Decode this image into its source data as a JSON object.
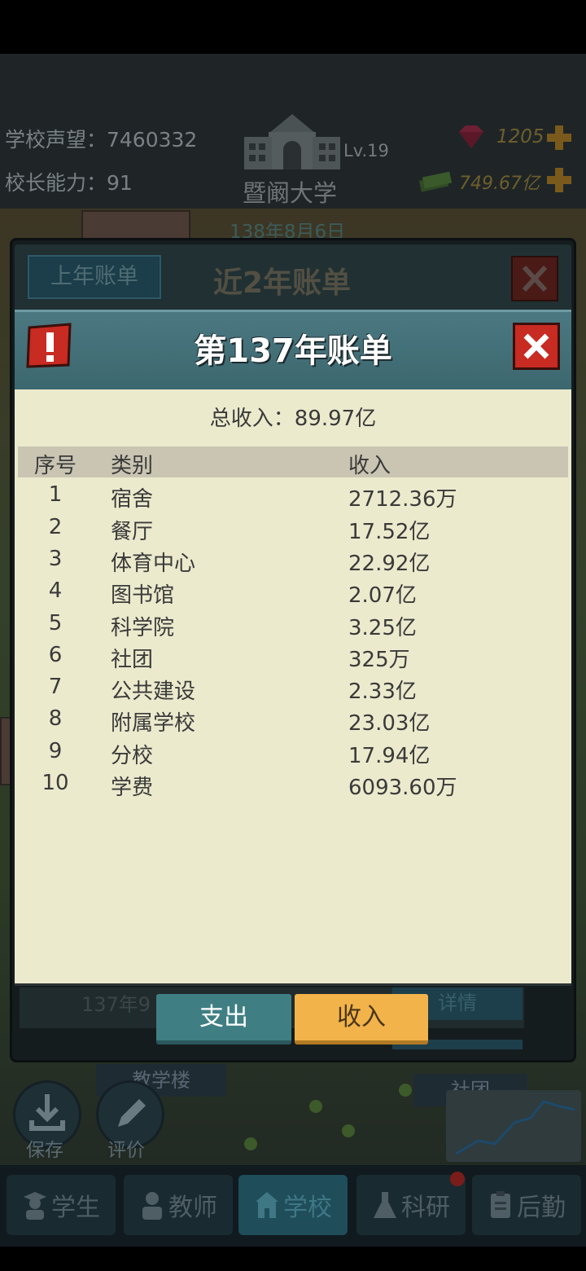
{
  "header": {
    "reputation_label": "学校声望：7460332",
    "ability_label": "校长能力：91",
    "school_name": "暨阚大学",
    "school_level": "Lv.19",
    "gems": "1205",
    "money": "749.67亿",
    "game_date": "138年8月6日"
  },
  "back_dialog": {
    "last_year_button": "上年账单",
    "title": "近2年账单",
    "behind_text": "137年9",
    "detail_button": "详情"
  },
  "front_dialog": {
    "title": "第137年账单",
    "total_income": "总收入：89.97亿",
    "columns": [
      "序号",
      "类别",
      "收入"
    ],
    "rows": [
      {
        "idx": "1",
        "category": "宿舍",
        "income": "2712.36万"
      },
      {
        "idx": "2",
        "category": "餐厅",
        "income": "17.52亿"
      },
      {
        "idx": "3",
        "category": "体育中心",
        "income": "22.92亿"
      },
      {
        "idx": "4",
        "category": "图书馆",
        "income": "2.07亿"
      },
      {
        "idx": "5",
        "category": "科学院",
        "income": "3.25亿"
      },
      {
        "idx": "6",
        "category": "社团",
        "income": "325万"
      },
      {
        "idx": "7",
        "category": "公共建设",
        "income": "2.33亿"
      },
      {
        "idx": "8",
        "category": "附属学校",
        "income": "23.03亿"
      },
      {
        "idx": "9",
        "category": "分校",
        "income": "17.94亿"
      },
      {
        "idx": "10",
        "category": "学费",
        "income": "6093.60万"
      }
    ],
    "tabs": {
      "expense": "支出",
      "income": "收入"
    }
  },
  "map_labels": {
    "building": "教学楼",
    "club": "社团",
    "save": "保存",
    "review": "评价"
  },
  "nav": [
    {
      "label": "学生",
      "icon": "student-icon"
    },
    {
      "label": "教师",
      "icon": "teacher-icon"
    },
    {
      "label": "学校",
      "icon": "school-icon",
      "active": true
    },
    {
      "label": "科研",
      "icon": "flask-icon"
    },
    {
      "label": "后勤",
      "icon": "clipboard-icon"
    }
  ],
  "colors": {
    "accent_income_tab": "#f1b34a",
    "expense_tab": "#3f7f84",
    "close_red": "#c72b22",
    "dialog_bg": "#ebeacd"
  }
}
